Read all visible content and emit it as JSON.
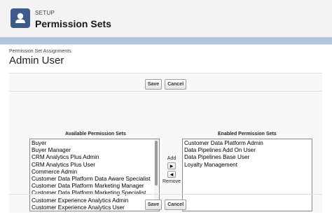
{
  "header": {
    "section": "SETUP",
    "title": "Permission Sets",
    "icon": "person-icon"
  },
  "assignment": {
    "subtitle": "Permission Set Assignments",
    "record_name": "Admin User"
  },
  "buttons": {
    "save": "Save",
    "cancel": "Cancel"
  },
  "available": {
    "heading": "Available Permission Sets",
    "items": [
      "Buyer",
      "Buyer Manager",
      "CRM Analytics Plus Admin",
      "CRM Analytics Plus User",
      "Commerce Admin",
      "Customer Data Platform Data Aware Specialist",
      "Customer Data Platform Marketing Manager",
      "Customer Data Platform Marketing Specialist",
      "Customer Experience Analytics Admin",
      "Customer Experience Analytics User"
    ]
  },
  "mover": {
    "add_label": "Add",
    "remove_label": "Remove",
    "add_arrow": "▶",
    "remove_arrow": "◀"
  },
  "enabled": {
    "heading": "Enabled Permission Sets",
    "items": [
      "Customer Data Platform Admin",
      "Data Pipelines Add On User",
      "Data Pipelines Base User",
      "Loyalty Management"
    ]
  },
  "colors": {
    "accent": "#3c5b8a",
    "background": "#b0c4df"
  }
}
